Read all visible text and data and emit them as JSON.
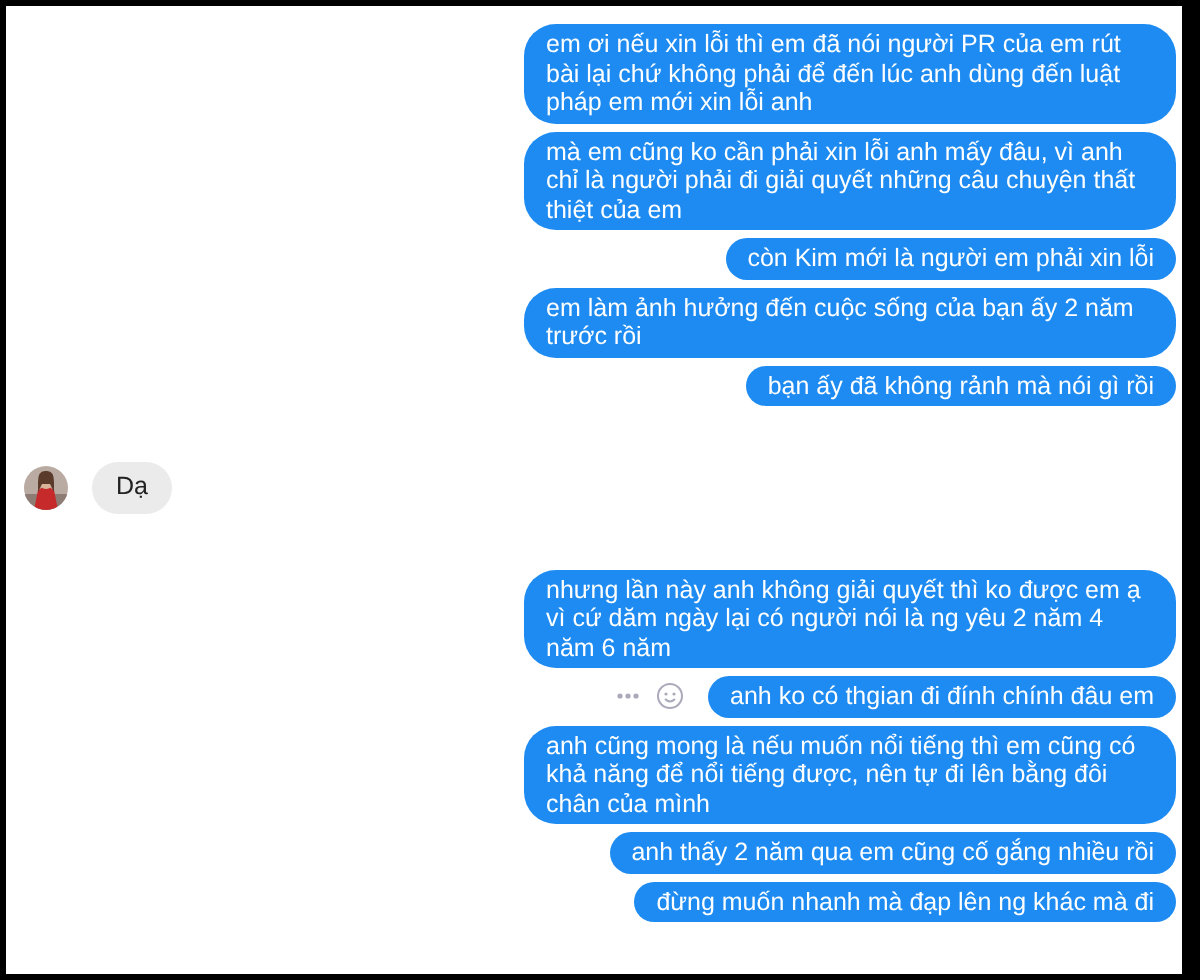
{
  "messages": [
    {
      "kind": "sent",
      "text": "em ơi nếu xin lỗi thì em đã nói người PR của em rút bài lại chứ không phải để đến lúc anh dùng đến luật pháp em mới xin lỗi anh",
      "actions": false
    },
    {
      "kind": "sent",
      "text": "mà em cũng ko cần phải xin lỗi anh mấy đâu, vì anh chỉ là người phải đi giải quyết những câu chuyện thất thiệt của em",
      "actions": false
    },
    {
      "kind": "sent",
      "text": "còn Kim mới là người em phải xin lỗi",
      "actions": false
    },
    {
      "kind": "sent",
      "text": "em làm ảnh hưởng đến cuộc sống của bạn ấy 2 năm trước rồi",
      "actions": false
    },
    {
      "kind": "sent",
      "text": "bạn ấy đã không rảnh mà nói gì rồi",
      "actions": false
    },
    {
      "kind": "received",
      "text": "Dạ",
      "actions": false
    },
    {
      "kind": "sent",
      "text": "nhưng lần này anh không giải quyết thì ko được em ạ vì cứ dăm ngày lại có người nói là ng yêu 2 năm 4 năm 6 năm",
      "actions": false
    },
    {
      "kind": "sent",
      "text": "anh ko có thgian đi đính chính đâu em",
      "actions": true
    },
    {
      "kind": "sent",
      "text": "anh cũng mong là nếu muốn nổi tiếng thì em cũng có khả năng để nổi tiếng được, nên tự đi lên bằng đôi chân của mình",
      "actions": false
    },
    {
      "kind": "sent",
      "text": "anh thấy 2 năm qua em cũng cố gắng nhiều rồi",
      "actions": false
    },
    {
      "kind": "sent",
      "text": "đừng muốn nhanh mà đạp lên ng khác mà đi",
      "actions": false
    }
  ]
}
